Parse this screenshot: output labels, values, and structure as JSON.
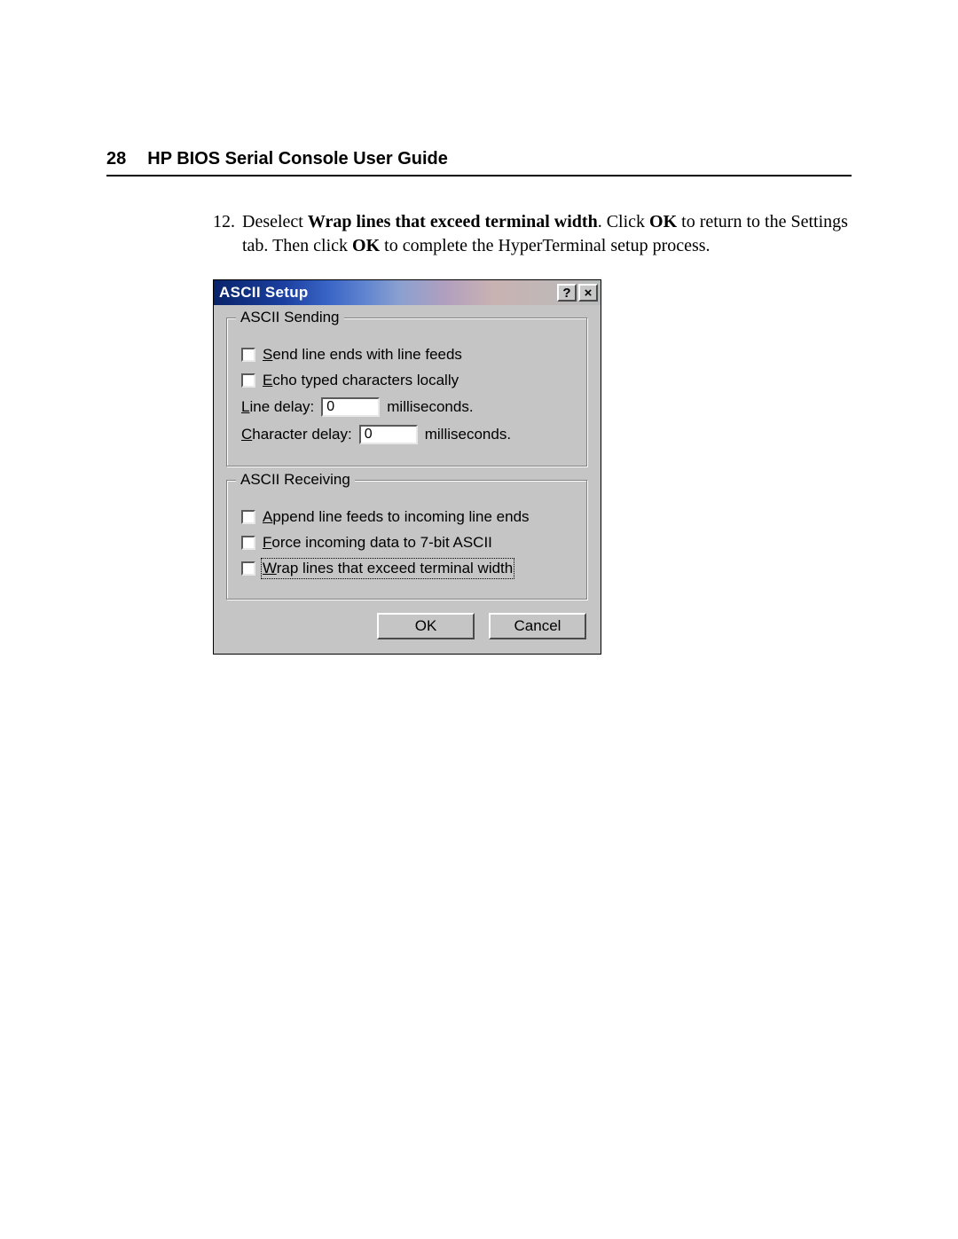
{
  "header": {
    "page_number": "28",
    "title": "HP BIOS Serial Console User Guide"
  },
  "instruction": {
    "number": "12.",
    "text_prefix": "Deselect ",
    "bold1": "Wrap lines that exceed terminal width",
    "mid1": ". Click ",
    "bold2": "OK",
    "mid2": " to return to the Settings tab. Then click ",
    "bold3": "OK",
    "suffix": " to complete the HyperTerminal setup process."
  },
  "dialog": {
    "title": "ASCII Setup",
    "help_glyph": "?",
    "close_glyph": "×",
    "sending": {
      "legend": "ASCII Sending",
      "send_line_ends": "Send line ends with line feeds",
      "echo_typed": "Echo typed characters locally",
      "line_delay_label": "Line delay:",
      "line_delay_value": "0",
      "char_delay_label": "Character delay:",
      "char_delay_value": "0",
      "ms_unit": "milliseconds."
    },
    "receiving": {
      "legend": "ASCII Receiving",
      "append_lf": "Append line feeds to incoming line ends",
      "force_7bit": "Force incoming data to 7-bit ASCII",
      "wrap_lines": "Wrap lines that exceed terminal width"
    },
    "buttons": {
      "ok": "OK",
      "cancel": "Cancel"
    }
  }
}
